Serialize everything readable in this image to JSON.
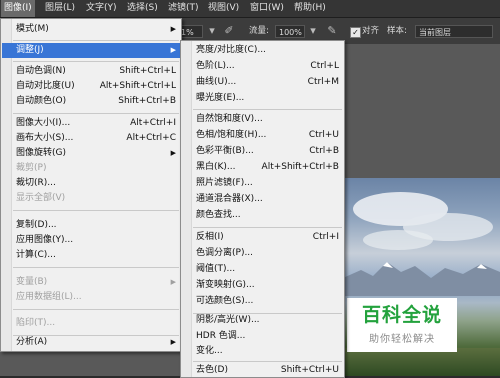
{
  "menubar": {
    "items": [
      {
        "label": "图像(I)",
        "active": true
      },
      {
        "label": "图层(L)"
      },
      {
        "label": "文字(Y)"
      },
      {
        "label": "选择(S)"
      },
      {
        "label": "滤镜(T)"
      },
      {
        "label": "视图(V)"
      },
      {
        "label": "窗口(W)"
      },
      {
        "label": "帮助(H)"
      }
    ]
  },
  "options": {
    "opacity_value": "1%",
    "flow_label": "流量:",
    "flow_value": "100%",
    "align_label": "对齐",
    "sample_label": "样本:",
    "sample_value": "当前图层"
  },
  "image_menu": {
    "items": [
      {
        "label": "模式(M)",
        "arrow": "▶"
      },
      {
        "label": "调整(J)",
        "arrow": "▶",
        "highlight": true
      },
      {
        "label": "自动色调(N)",
        "shortcut": "Shift+Ctrl+L"
      },
      {
        "label": "自动对比度(U)",
        "shortcut": "Alt+Shift+Ctrl+L"
      },
      {
        "label": "自动颜色(O)",
        "shortcut": "Shift+Ctrl+B"
      },
      {
        "label": "图像大小(I)...",
        "shortcut": "Alt+Ctrl+I"
      },
      {
        "label": "画布大小(S)...",
        "shortcut": "Alt+Ctrl+C"
      },
      {
        "label": "图像旋转(G)",
        "arrow": "▶"
      },
      {
        "label": "裁剪(P)",
        "disabled": true
      },
      {
        "label": "裁切(R)..."
      },
      {
        "label": "显示全部(V)",
        "disabled": true
      },
      {
        "label": "复制(D)..."
      },
      {
        "label": "应用图像(Y)..."
      },
      {
        "label": "计算(C)..."
      },
      {
        "label": "变量(B)",
        "arrow": "▶",
        "disabled": true
      },
      {
        "label": "应用数据组(L)...",
        "disabled": true
      },
      {
        "label": "陷印(T)...",
        "disabled": true
      },
      {
        "label": "分析(A)",
        "arrow": "▶"
      }
    ]
  },
  "adjust_menu": {
    "items": [
      {
        "label": "亮度/对比度(C)..."
      },
      {
        "label": "色阶(L)...",
        "shortcut": "Ctrl+L"
      },
      {
        "label": "曲线(U)...",
        "shortcut": "Ctrl+M"
      },
      {
        "label": "曝光度(E)..."
      },
      {
        "label": "自然饱和度(V)..."
      },
      {
        "label": "色相/饱和度(H)...",
        "shortcut": "Ctrl+U"
      },
      {
        "label": "色彩平衡(B)...",
        "shortcut": "Ctrl+B"
      },
      {
        "label": "黑白(K)...",
        "shortcut": "Alt+Shift+Ctrl+B"
      },
      {
        "label": "照片滤镜(F)..."
      },
      {
        "label": "通道混合器(X)..."
      },
      {
        "label": "颜色查找..."
      },
      {
        "label": "反相(I)",
        "shortcut": "Ctrl+I"
      },
      {
        "label": "色调分离(P)..."
      },
      {
        "label": "阈值(T)..."
      },
      {
        "label": "渐变映射(G)..."
      },
      {
        "label": "可选颜色(S)..."
      },
      {
        "label": "阴影/高光(W)..."
      },
      {
        "label": "HDR 色调..."
      },
      {
        "label": "变化..."
      },
      {
        "label": "去色(D)",
        "shortcut": "Shift+Ctrl+U"
      }
    ]
  },
  "watermark": {
    "title": "百科全说",
    "subtitle": "助你轻松解决"
  }
}
